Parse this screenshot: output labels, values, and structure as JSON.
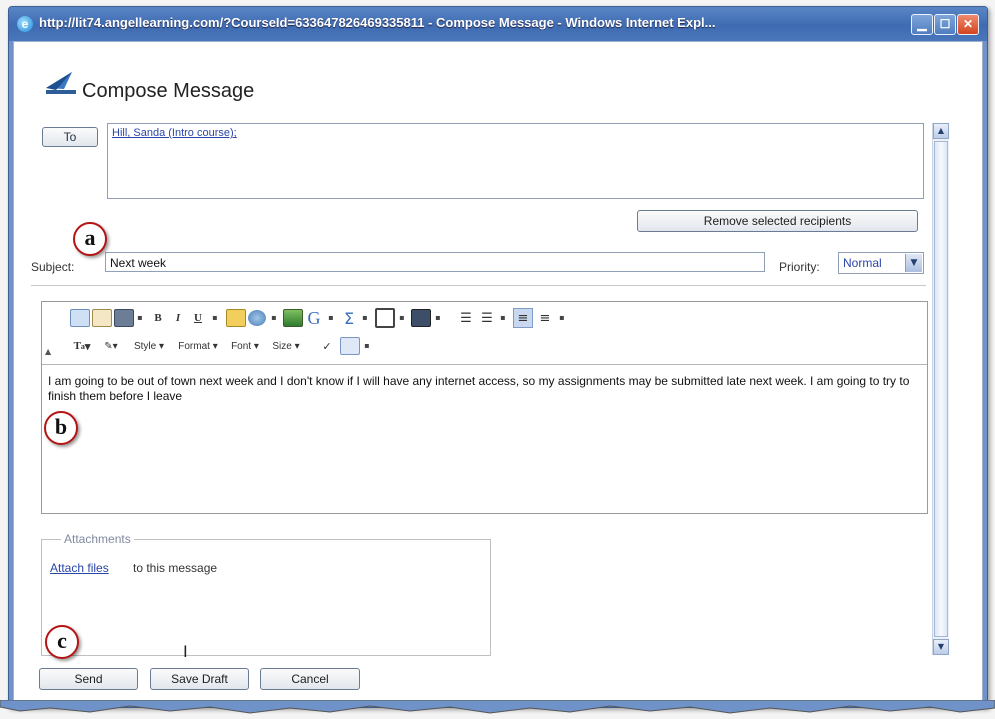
{
  "window": {
    "title": "http://lit74.angellearning.com/?CourseId=633647826469335811 - Compose Message - Windows Internet Expl...",
    "icon": "ie-icon",
    "controls": {
      "minimize": "▁",
      "maximize": "☐",
      "close": "✕"
    }
  },
  "header": {
    "title": "Compose Message",
    "icon": "compose-message-icon"
  },
  "to": {
    "button_label": "To",
    "recipients": [
      "Hill, Sanda (Intro course);"
    ],
    "remove_label": "Remove selected recipients"
  },
  "subject": {
    "label": "Subject:",
    "value": "Next week"
  },
  "priority": {
    "label": "Priority:",
    "value": "Normal"
  },
  "editor": {
    "toolbar_row2": {
      "style": "Style",
      "format": "Format",
      "font": "Font",
      "size": "Size"
    },
    "body": "I am going to be out of town next week and I don't know if I will have any internet access, so my assignments may be submitted late next week.  I am going to try to finish them before I leave"
  },
  "attachments": {
    "legend": "Attachments",
    "link": "Attach files",
    "text": "to this message"
  },
  "buttons": {
    "send": "Send",
    "save_draft": "Save Draft",
    "cancel": "Cancel"
  },
  "callouts": {
    "a": "a",
    "b": "b",
    "c": "c"
  },
  "colors": {
    "titlebar": "#3e6bb1",
    "link": "#2a45a8",
    "callout_border": "#b51414"
  }
}
